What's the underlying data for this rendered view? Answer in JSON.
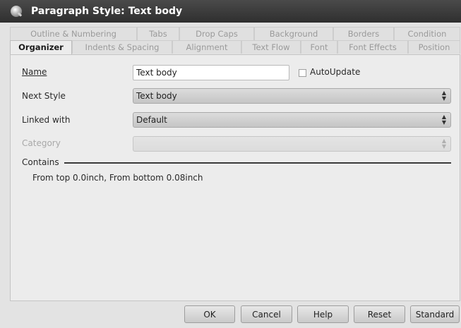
{
  "window": {
    "title": "Paragraph Style: Text body"
  },
  "tabs": {
    "back_row": [
      "Outline & Numbering",
      "Tabs",
      "Drop Caps",
      "Background",
      "Borders",
      "Condition"
    ],
    "front_row": [
      "Organizer",
      "Indents & Spacing",
      "Alignment",
      "Text Flow",
      "Font",
      "Font Effects",
      "Position"
    ],
    "active": "Organizer"
  },
  "organizer": {
    "name_label": "Name",
    "name_value": "Text body",
    "autoupdate_label": "AutoUpdate",
    "autoupdate_checked": false,
    "next_style_label": "Next Style",
    "next_style_value": "Text body",
    "linked_with_label": "Linked with",
    "linked_with_value": "Default",
    "category_label": "Category",
    "category_value": "",
    "contains_label": "Contains",
    "contains_text": "From top 0.0inch, From bottom 0.08inch"
  },
  "buttons": {
    "ok": "OK",
    "cancel": "Cancel",
    "help": "Help",
    "reset": "Reset",
    "standard": "Standard"
  }
}
